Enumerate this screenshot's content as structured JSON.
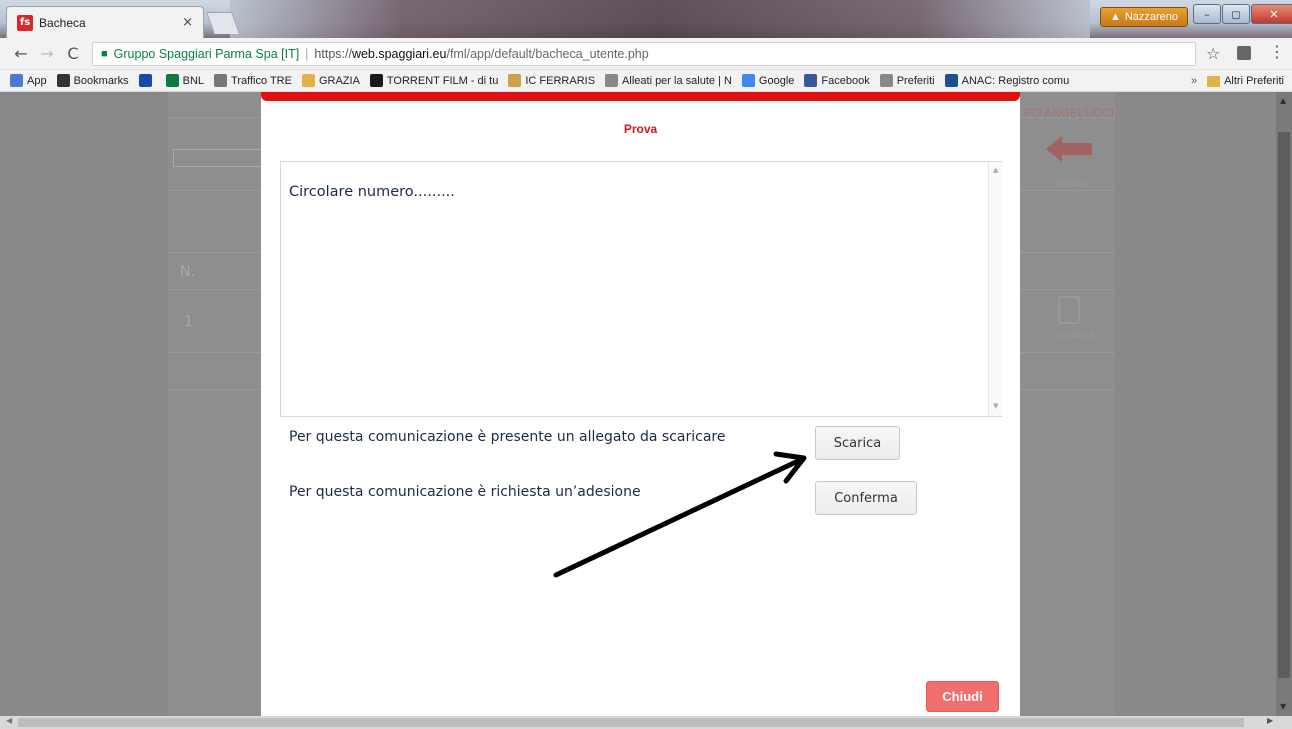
{
  "browser": {
    "tab_title": "Bacheca",
    "tab_icon_text": "fs",
    "tab_close": "×",
    "user_name": "Nazzareno",
    "window_buttons": [
      "–",
      "◻",
      "✕"
    ],
    "nav": {
      "back": "←",
      "forward": "→",
      "reload": "C"
    },
    "address": {
      "site_identity": "Gruppo Spaggiari Parma Spa [IT]",
      "scheme": "https://",
      "host": "web.spaggiari.eu",
      "path": "/fml/app/default/bacheca_utente.php"
    },
    "star": "☆",
    "menu": "⋮"
  },
  "bookmarks": {
    "items": [
      {
        "label": "App",
        "icon": "apps-grid-icon",
        "color": "#4a7bd0"
      },
      {
        "label": "Bookmarks",
        "icon": "star-icon",
        "color": "#333333"
      },
      {
        "label": "",
        "icon": "shield-icon",
        "color": "#1a4aa8"
      },
      {
        "label": "BNL",
        "icon": "bnl-icon",
        "color": "#0f7a3e"
      },
      {
        "label": "Traffico TRE",
        "icon": "tre-icon",
        "color": "#777777"
      },
      {
        "label": "GRAZIA",
        "icon": "folder-icon",
        "color": "#e0b347"
      },
      {
        "label": "TORRENT FILM - di tu",
        "icon": "torrent-icon",
        "color": "#1a1a1a"
      },
      {
        "label": "IC FERRARIS",
        "icon": "emblem-icon",
        "color": "#c9a24a"
      },
      {
        "label": "Alleati per la salute | N",
        "icon": "page-icon",
        "color": "#888888"
      },
      {
        "label": "Google",
        "icon": "google-icon",
        "color": "#4285f4"
      },
      {
        "label": "Facebook",
        "icon": "facebook-icon",
        "color": "#3b5998"
      },
      {
        "label": "Preferiti",
        "icon": "page-icon",
        "color": "#888888"
      },
      {
        "label": "ANAC: Registro comu",
        "icon": "anac-icon",
        "color": "#1d4f91"
      }
    ],
    "overflow": "»",
    "other_label": "Altri Preferiti"
  },
  "background": {
    "teacher": "PO ANGELUCCI",
    "back_label": "Indietro",
    "col_n": "N.",
    "row_1": "1",
    "view_label": "Visualizza"
  },
  "modal": {
    "title": "Prova",
    "message": "Circolare numero.........",
    "attachment_text": "Per questa comunicazione è presente un allegato da scaricare",
    "download_label": "Scarica",
    "adhesion_text": "Per questa comunicazione è richiesta un’adesione",
    "confirm_label": "Conferma",
    "close_label": "Chiudi"
  },
  "colors": {
    "accent_red": "#e01010",
    "close_button": "#f07070"
  }
}
